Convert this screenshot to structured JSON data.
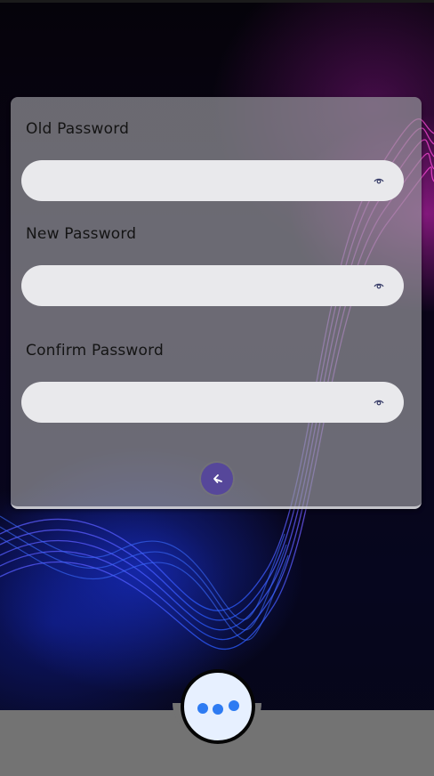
{
  "form": {
    "old_password": {
      "label": "Old Password",
      "value": "",
      "icon": "eye-icon"
    },
    "new_password": {
      "label": "New Password",
      "value": "",
      "icon": "eye-icon"
    },
    "confirm_password": {
      "label": "Confirm Password",
      "value": "",
      "icon": "eye-icon"
    }
  },
  "actions": {
    "back_icon": "arrow-left-icon",
    "more_icon": "more-horizontal-icon"
  },
  "colors": {
    "card": "#96969b",
    "field": "#e9e9ec",
    "back_button": "#56479a",
    "bottom_bar": "#737373",
    "fab": "#e7f0ff",
    "fab_dots": "#2e7bf2"
  }
}
